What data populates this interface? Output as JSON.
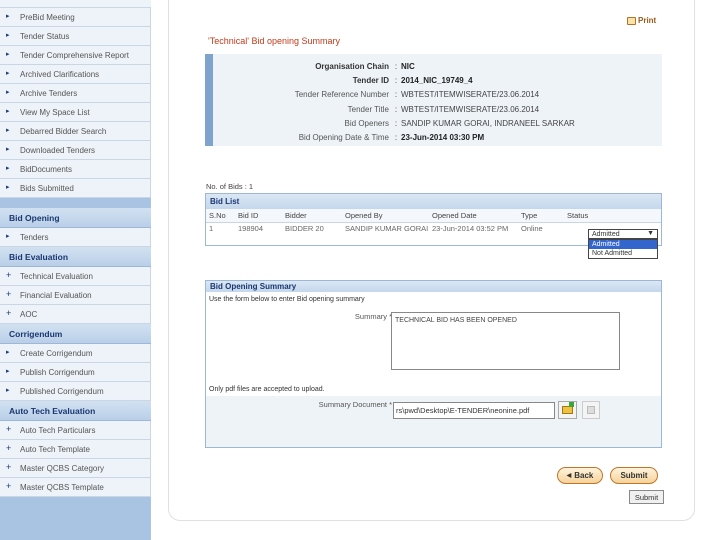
{
  "sidebar": {
    "items_top": [
      {
        "label": "PreBid Meeting"
      },
      {
        "label": "Tender Status"
      },
      {
        "label": "Tender Comprehensive Report"
      },
      {
        "label": "Archived Clarifications"
      },
      {
        "label": "Archive Tenders"
      },
      {
        "label": "View My Space List"
      },
      {
        "label": "Debarred Bidder Search"
      },
      {
        "label": "Downloaded Tenders"
      },
      {
        "label": "BidDocuments"
      },
      {
        "label": "Bids Submitted"
      }
    ],
    "section_bid_opening": {
      "title": "Bid Opening",
      "items": [
        {
          "label": "Tenders"
        }
      ]
    },
    "section_bid_evaluation": {
      "title": "Bid Evaluation",
      "items": [
        {
          "label": "Technical Evaluation"
        },
        {
          "label": "Financial Evaluation"
        },
        {
          "label": "AOC"
        }
      ]
    },
    "section_corrigendum": {
      "title": "Corrigendum",
      "items": [
        {
          "label": "Create Corrigendum"
        },
        {
          "label": "Publish Corrigendum"
        },
        {
          "label": "Published Corrigendum"
        }
      ]
    },
    "section_auto_tech": {
      "title": "Auto Tech Evaluation",
      "items": [
        {
          "label": "Auto Tech Particulars"
        },
        {
          "label": "Auto Tech Template"
        },
        {
          "label": "Master QCBS Category"
        },
        {
          "label": "Master QCBS Template"
        }
      ]
    }
  },
  "header": {
    "print_label": "Print",
    "title": "'Technical' Bid opening Summary"
  },
  "org_details": [
    {
      "label": "Organisation Chain",
      "value": "NIC",
      "bold": true
    },
    {
      "label": "Tender ID",
      "value": "2014_NIC_19749_4",
      "bold": true
    },
    {
      "label": "Tender Reference Number",
      "value": "WBTEST/ITEMWISERATE/23.06.2014",
      "bold": false
    },
    {
      "label": "Tender Title",
      "value": "WBTEST/ITEMWISERATE/23.06.2014",
      "bold": false
    },
    {
      "label": "Bid Openers",
      "value": "SANDIP KUMAR GORAI, INDRANEEL SARKAR",
      "bold": false
    },
    {
      "label": "Bid Opening Date & Time",
      "value": "23-Jun-2014 03:30 PM",
      "bold": true
    }
  ],
  "bid_count": "No. of Bids : 1",
  "bid_list": {
    "title": "Bid List",
    "columns": [
      "S.No",
      "Bid ID",
      "Bidder",
      "Opened By",
      "Opened Date",
      "Type",
      "Status"
    ],
    "rows": [
      {
        "sno": "1",
        "bid_id": "198904",
        "bidder": "BIDDER 20",
        "opened_by": "SANDIP KUMAR GORAI",
        "opened_date": "23-Jun-2014 03:52 PM",
        "type": "Online"
      }
    ],
    "status_selected": "Admitted",
    "status_options": [
      "Admitted",
      "Not Admitted"
    ]
  },
  "bid_opening_summary": {
    "title": "Bid Opening Summary",
    "instruction": "Use the form below to enter Bid opening summary",
    "summary_label": "Summary *",
    "summary_value": "TECHNICAL BID HAS BEEN OPENED",
    "pdf_note": "Only pdf files are accepted to upload.",
    "document_label": "Summary Document *",
    "document_value": "rs\\pwd\\Desktop\\E-TENDER\\neonine.pdf"
  },
  "actions": {
    "back_label": "Back",
    "submit_label": "Submit",
    "submit2_label": "Submit"
  }
}
